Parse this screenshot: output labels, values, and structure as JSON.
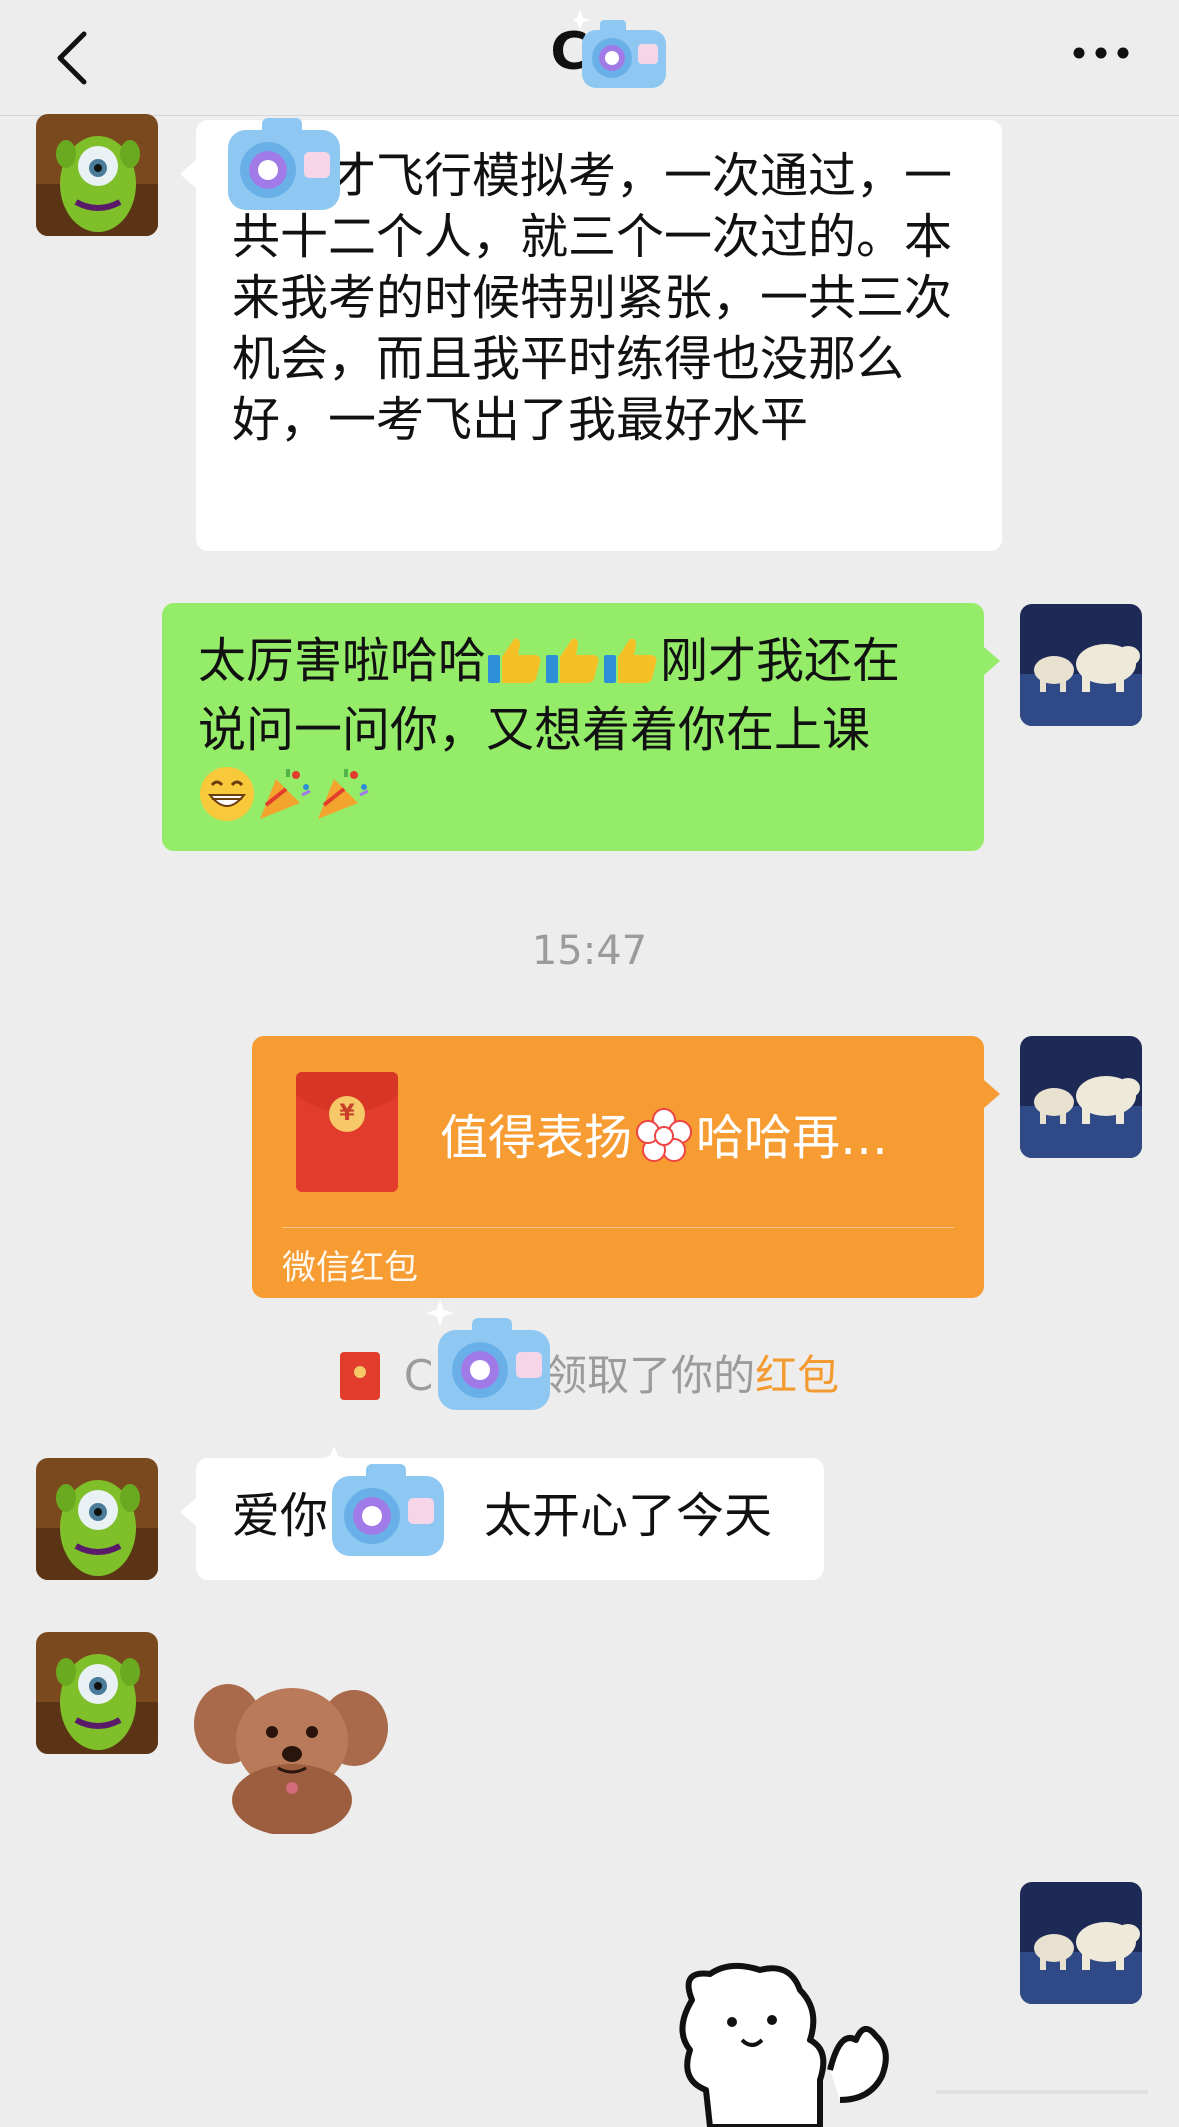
{
  "header": {
    "title": "CC",
    "back_icon": "chevron-left-icon",
    "more_icon": "more-dots-icon"
  },
  "messages": [
    {
      "side": "left",
      "text": "我刚才飞行模拟考，一次通过，一共十二个人，就三个一次过的。本来我考的时候特别紧张，一共三次机会，而且我平时练得也没那么好，一考飞出了我最好水平"
    },
    {
      "side": "right",
      "text": "太厉害啦哈哈",
      "text_after_thumbs": "刚才我还在说问一问你，又想着着你在上课",
      "emojis": [
        "thumbs-up",
        "thumbs-up",
        "thumbs-up",
        "grin",
        "party-popper",
        "party-popper"
      ]
    }
  ],
  "timestamp": "15:47",
  "red_packet": {
    "message": "值得表扬",
    "message_tail": "哈哈再…",
    "label": "微信红包"
  },
  "system_note": {
    "prefix": "C",
    "middle": "领取了你的",
    "link": "红包"
  },
  "message3": {
    "part1": "爱你",
    "part2": "太开心了今天"
  },
  "colors": {
    "background": "#ededed",
    "own_bubble": "#95ec69",
    "other_bubble": "#ffffff",
    "red_packet": "#f79c33",
    "link": "#f39a31"
  }
}
